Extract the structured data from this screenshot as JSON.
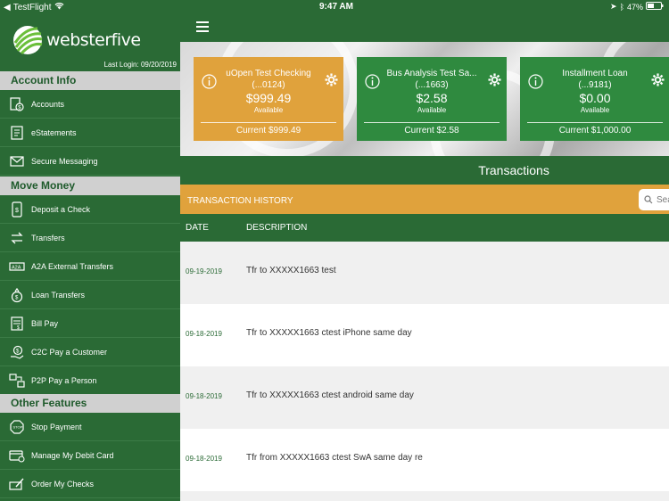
{
  "status": {
    "back_app": "TestFlight",
    "time": "9:47 AM",
    "battery": "47%"
  },
  "sidebar": {
    "logo_text": "websterfive",
    "last_login_label": "Last Login:",
    "last_login_date": "09/20/2019",
    "sections": [
      {
        "title": "Account Info"
      },
      {
        "title": "Move Money"
      },
      {
        "title": "Other Features"
      }
    ],
    "items": [
      {
        "label": "Accounts"
      },
      {
        "label": "eStatements"
      },
      {
        "label": "Secure Messaging"
      },
      {
        "label": "Deposit a Check"
      },
      {
        "label": "Transfers"
      },
      {
        "label": "A2A External Transfers"
      },
      {
        "label": "Loan Transfers"
      },
      {
        "label": "Bill Pay"
      },
      {
        "label": "C2C Pay a Customer"
      },
      {
        "label": "P2P Pay a Person"
      },
      {
        "label": "Stop Payment"
      },
      {
        "label": "Manage My Debit Card"
      },
      {
        "label": "Order My Checks"
      }
    ]
  },
  "cards": [
    {
      "name": "uOpen Test Checking",
      "number": "(...0124)",
      "balance": "$999.49",
      "available_label": "Available",
      "current": "Current $999.49",
      "color": "#e0a23c"
    },
    {
      "name": "Bus Analysis Test Sa...",
      "number": "(...1663)",
      "balance": "$2.58",
      "available_label": "Available",
      "current": "Current $2.58",
      "color": "#2f8a3f"
    },
    {
      "name": "Installment Loan",
      "number": "(...9181)",
      "balance": "$0.00",
      "available_label": "Available",
      "current": "Current $1,000.00",
      "color": "#2f8a3f"
    }
  ],
  "transactions": {
    "title": "Transactions",
    "history_label": "TRANSACTION HISTORY",
    "search_placeholder": "Sear",
    "col_date": "DATE",
    "col_desc": "DESCRIPTION",
    "rows": [
      {
        "date": "09-19-2019",
        "desc": "Tfr to XXXXX1663 test"
      },
      {
        "date": "09-18-2019",
        "desc": "Tfr to XXXXX1663 ctest iPhone same day"
      },
      {
        "date": "09-18-2019",
        "desc": "Tfr to XXXXX1663 ctest android same day"
      },
      {
        "date": "09-18-2019",
        "desc": "Tfr from XXXXX1663 ctest SwA same day re"
      }
    ]
  },
  "colors": {
    "brand_green": "#2a6a35",
    "accent_orange": "#e0a23c",
    "card_green": "#2f8a3f"
  }
}
